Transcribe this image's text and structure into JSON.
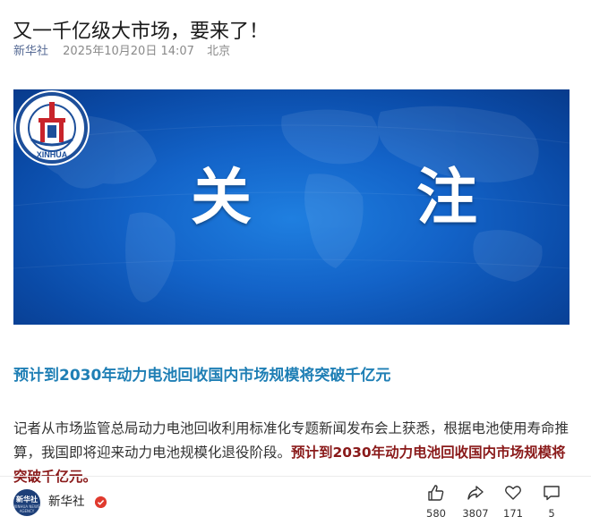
{
  "article": {
    "title": "又一千亿级大市场，要来了！",
    "source": "新华社",
    "date": "2025年10月20日 14:07",
    "location": "北京"
  },
  "banner": {
    "char1": "关",
    "char2": "注",
    "logo_text": "XINHUA",
    "bg_color": "#1363c8"
  },
  "content": {
    "subheading": "预计到2030年动力电池回收国内市场规模将突破千亿元",
    "paragraph_plain": "记者从市场监管总局动力电池回收利用标准化专题新闻发布会上获悉，根据电池使用寿命推算，我国即将迎来动力电池规模化退役阶段。",
    "paragraph_highlight": "预计到2030年动力电池回收国内市场规模将突破千亿元。",
    "subheading_color": "#1f7fb5",
    "highlight_color": "#8a1a1a"
  },
  "footer": {
    "author": "新华社",
    "avatar_text": "新华社",
    "avatar_subtext": "XINHUA NEWS AGENCY",
    "actions": [
      {
        "icon": "thumbs-up-icon",
        "count": "580"
      },
      {
        "icon": "share-icon",
        "count": "3807"
      },
      {
        "icon": "heart-icon",
        "count": "171"
      },
      {
        "icon": "comment-icon",
        "count": "5"
      }
    ]
  }
}
